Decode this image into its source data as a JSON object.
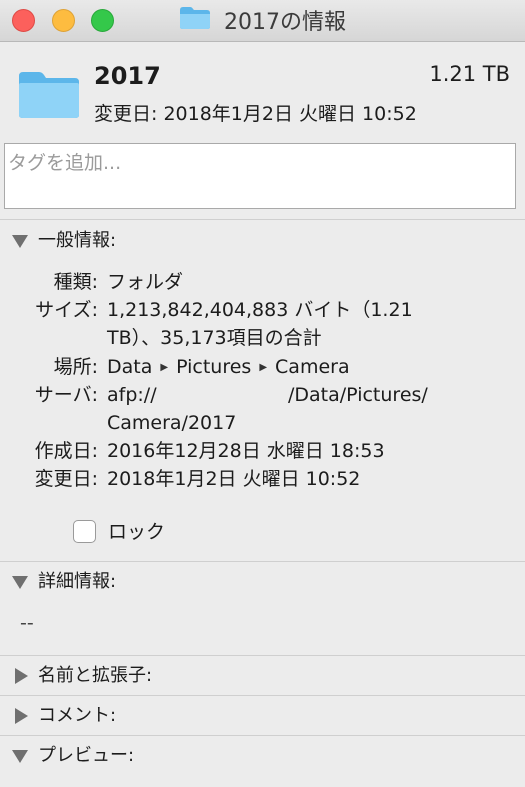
{
  "window": {
    "title": "2017の情報"
  },
  "header": {
    "name": "2017",
    "size": "1.21 TB",
    "modified": "変更日: 2018年1月2日 火曜日 10:52"
  },
  "tags": {
    "placeholder": "タグを追加..."
  },
  "general": {
    "title": "一般情報:",
    "kind_label": "種類:",
    "kind_value": "フォルダ",
    "size_label": "サイズ:",
    "size_value_line1": "1,213,842,404,883 バイト（1.21",
    "size_value_line2": "TB）、35,173項目の合計",
    "where_label": "場所:",
    "where_path": [
      "Data",
      "Pictures",
      "Camera"
    ],
    "server_label": "サーバ:",
    "server_prefix": "afp://",
    "server_suffix": "/Data/Pictures/",
    "server_line2": "Camera/2017",
    "created_label": "作成日:",
    "created_value": "2016年12月28日 水曜日 18:53",
    "modified_label": "変更日:",
    "modified_value": "2018年1月2日 火曜日 10:52",
    "lock_label": "ロック",
    "lock_checked": false
  },
  "more_info": {
    "title": "詳細情報:",
    "value": "--"
  },
  "name_extension": {
    "title": "名前と拡張子:"
  },
  "comments": {
    "title": "コメント:"
  },
  "preview": {
    "title": "プレビュー:"
  },
  "colors": {
    "folder_light": "#8fd3f7",
    "folder_dark": "#5cb6ea",
    "traffic_close": "#fc605c",
    "traffic_minimize": "#fdbc40",
    "traffic_zoom": "#34c84a"
  },
  "icons": {
    "folder": "folder-icon",
    "disclosure_open": "disclosure-triangle-down-icon",
    "disclosure_closed": "disclosure-triangle-right-icon",
    "path_separator": "path-arrow-icon"
  }
}
